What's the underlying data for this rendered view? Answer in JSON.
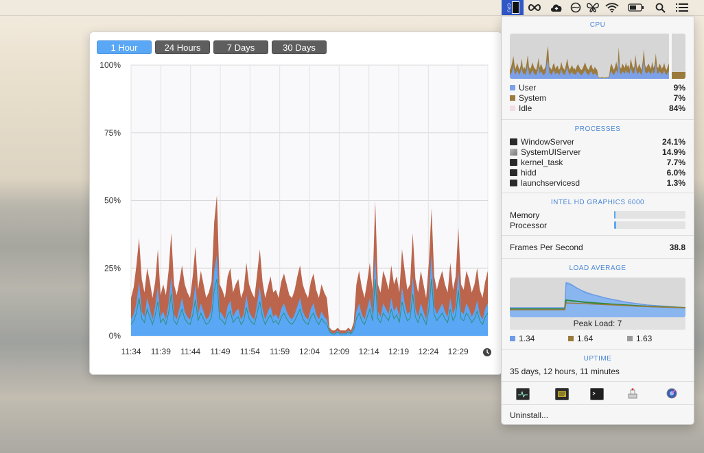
{
  "menubar": {
    "cpu_label": "CPU",
    "icons": [
      "cpu-meter-icon",
      "infinity-icon",
      "cloud-upload-icon",
      "sync-icon",
      "butterfly-icon",
      "wifi-icon",
      "battery-icon",
      "search-icon",
      "menu-list-icon"
    ]
  },
  "history": {
    "tabs": [
      "1 Hour",
      "24 Hours",
      "7 Days",
      "30 Days"
    ],
    "active_tab": 0
  },
  "chart_data": {
    "type": "area",
    "y_ticks": [
      "100%",
      "75%",
      "50%",
      "25%",
      "0%"
    ],
    "ylim": [
      0,
      100
    ],
    "x_ticks": [
      "11:34",
      "11:39",
      "11:44",
      "11:49",
      "11:54",
      "11:59",
      "12:04",
      "12:09",
      "12:14",
      "12:19",
      "12:24",
      "12:29"
    ],
    "series": [
      {
        "name": "User",
        "color": "#5aa7f5"
      },
      {
        "name": "System",
        "color": "#b5543a"
      }
    ],
    "user_samples": [
      6,
      8,
      12,
      20,
      9,
      7,
      14,
      10,
      6,
      11,
      18,
      7,
      9,
      6,
      12,
      22,
      8,
      6,
      10,
      14,
      9,
      7,
      6,
      11,
      19,
      8,
      12,
      9,
      6,
      7,
      10,
      24,
      30,
      9,
      8,
      6,
      11,
      13,
      7,
      9,
      10,
      6,
      8,
      15,
      9,
      7,
      6,
      12,
      18,
      10,
      6,
      9,
      11,
      7,
      8,
      6,
      10,
      12,
      9,
      7,
      6,
      8,
      11,
      14,
      9,
      7,
      6,
      10,
      12,
      8,
      6,
      9,
      7,
      6,
      2,
      1,
      1,
      2,
      1,
      1,
      1,
      2,
      1,
      3,
      9,
      12,
      8,
      6,
      10,
      14,
      8,
      30,
      9,
      7,
      12,
      10,
      8,
      14,
      9,
      11,
      7,
      18,
      12,
      8,
      9,
      22,
      10,
      7,
      12,
      9,
      6,
      14,
      30,
      11,
      8,
      10,
      12,
      9,
      7,
      14,
      8,
      11,
      24,
      9,
      8,
      12,
      10,
      7,
      9,
      13,
      8,
      6,
      10,
      12
    ],
    "system_samples": [
      8,
      10,
      14,
      16,
      12,
      9,
      11,
      10,
      8,
      9,
      14,
      8,
      10,
      9,
      12,
      16,
      11,
      9,
      10,
      12,
      10,
      9,
      8,
      11,
      14,
      9,
      12,
      10,
      8,
      9,
      10,
      18,
      22,
      10,
      9,
      8,
      11,
      12,
      9,
      10,
      11,
      8,
      9,
      12,
      10,
      9,
      8,
      11,
      14,
      10,
      8,
      9,
      11,
      9,
      9,
      8,
      10,
      11,
      10,
      8,
      8,
      9,
      11,
      12,
      10,
      9,
      8,
      10,
      11,
      9,
      8,
      10,
      9,
      8,
      1,
      1,
      1,
      1,
      1,
      1,
      1,
      1,
      1,
      2,
      10,
      12,
      10,
      8,
      10,
      13,
      9,
      20,
      10,
      9,
      12,
      11,
      9,
      12,
      10,
      11,
      9,
      14,
      12,
      9,
      10,
      16,
      11,
      9,
      12,
      10,
      8,
      13,
      17,
      11,
      9,
      11,
      12,
      10,
      9,
      13,
      9,
      11,
      16,
      10,
      9,
      12,
      11,
      9,
      10,
      12,
      9,
      8,
      10,
      12
    ]
  },
  "panel": {
    "cpu": {
      "title": "CPU",
      "rows": [
        {
          "name": "User",
          "value": "9%",
          "color": "#7da1e8"
        },
        {
          "name": "System",
          "value": "7%",
          "color": "#9b7a3d"
        },
        {
          "name": "Idle",
          "value": "84%",
          "color": "#f2dde3"
        }
      ]
    },
    "processes": {
      "title": "PROCESSES",
      "rows": [
        {
          "name": "WindowServer",
          "value": "24.1%",
          "icon": "terminal-icon"
        },
        {
          "name": "SystemUIServer",
          "value": "14.9%",
          "icon": "app-icon"
        },
        {
          "name": "kernel_task",
          "value": "7.7%",
          "icon": "terminal-icon"
        },
        {
          "name": "hidd",
          "value": "6.0%",
          "icon": "terminal-icon"
        },
        {
          "name": "launchservicesd",
          "value": "1.3%",
          "icon": "terminal-icon"
        }
      ]
    },
    "gpu": {
      "title": "INTEL HD GRAPHICS 6000",
      "memory_label": "Memory",
      "memory_level": 0.01,
      "processor_label": "Processor",
      "processor_level": 0.03,
      "fps_label": "Frames Per Second",
      "fps_value": "38.8"
    },
    "load": {
      "title": "LOAD AVERAGE",
      "peak_label": "Peak Load: 7",
      "values": [
        {
          "value": "1.34",
          "color": "#6e9be6"
        },
        {
          "value": "1.64",
          "color": "#9b7a3d"
        },
        {
          "value": "1.63",
          "color": "#9a9a9a"
        }
      ]
    },
    "uptime": {
      "title": "UPTIME",
      "value": "35 days, 12 hours, 11 minutes"
    },
    "toolbar_icons": [
      "activity-monitor-icon",
      "console-icon",
      "terminal-icon",
      "system-info-icon",
      "disk-utility-icon"
    ],
    "uninstall_label": "Uninstall..."
  }
}
